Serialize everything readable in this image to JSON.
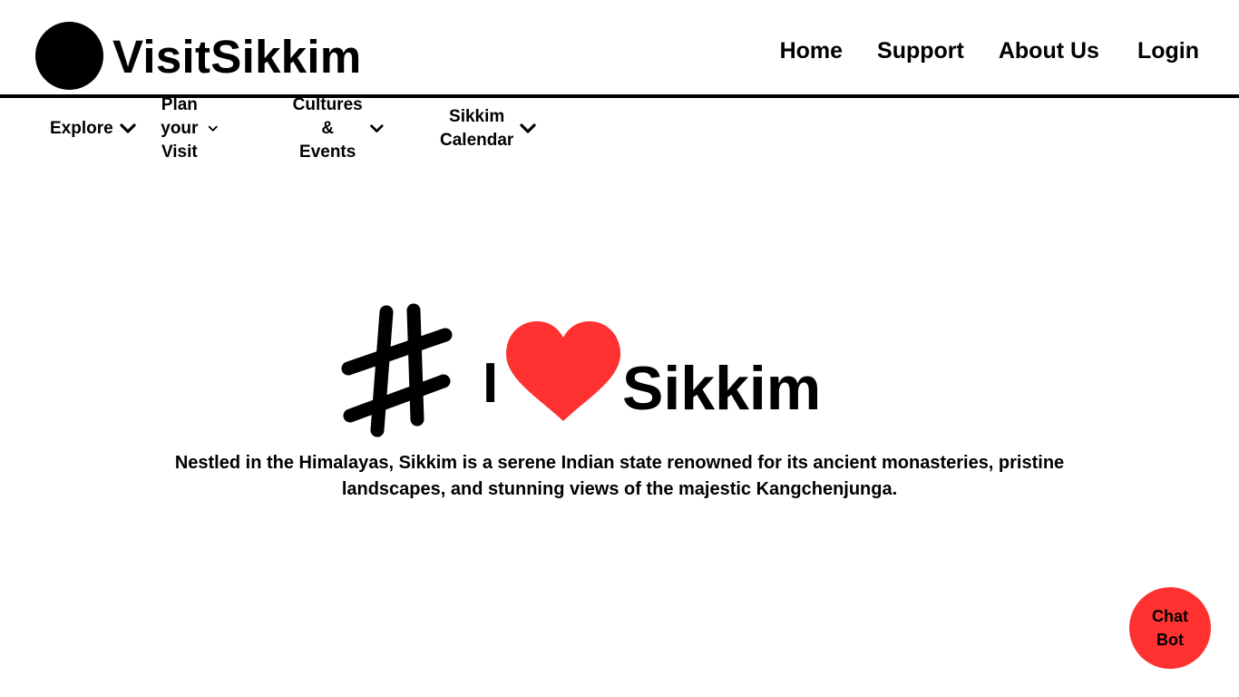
{
  "brand": {
    "name": "VisitSikkim"
  },
  "topnav": {
    "home": "Home",
    "support": "Support",
    "about": "About Us",
    "login": "Login"
  },
  "subnav": {
    "explore": {
      "label": "Explore"
    },
    "plan": {
      "line1": "Plan your",
      "line2": "Visit"
    },
    "cultures": {
      "line1": "Cultures &",
      "line2": "Events"
    },
    "calendar": {
      "line1": "Sikkim",
      "line2": "Calendar"
    }
  },
  "hero": {
    "hashtag_icon": "hashtag-icon",
    "letter": "I",
    "heart_icon": "heart-icon",
    "heart_color": "#ff3131",
    "word": "Sikkim",
    "description": "Nestled in the Himalayas, Sikkim is a serene Indian state renowned for its ancient monasteries, pristine landscapes, and stunning views of the majestic Kangchenjunga."
  },
  "chatbot": {
    "line1": "Chat",
    "line2": "Bot",
    "color": "#ff3131"
  }
}
